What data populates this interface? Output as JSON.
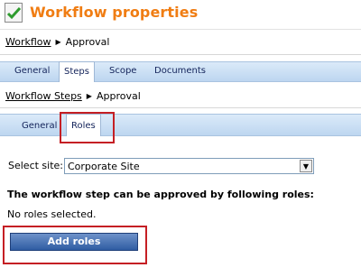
{
  "header": {
    "title": "Workflow properties",
    "icon": "checkmark-document-icon",
    "title_color": "#f07d13"
  },
  "breadcrumb_workflow": {
    "link": "Workflow",
    "separator": "▶",
    "current": "Approval"
  },
  "workflow_tabs": [
    {
      "label": "General",
      "active": false
    },
    {
      "label": "Steps",
      "active": true
    },
    {
      "label": "Scope",
      "active": false
    },
    {
      "label": "Documents",
      "active": false
    }
  ],
  "breadcrumb_steps": {
    "link": "Workflow Steps",
    "separator": "▶",
    "current": "Approval"
  },
  "step_tabs": [
    {
      "label": "General",
      "active": false
    },
    {
      "label": "Roles",
      "active": true
    }
  ],
  "site_selector": {
    "label": "Select site:",
    "value": "Corporate Site"
  },
  "roles": {
    "heading": "The workflow step can be approved by following roles:",
    "empty_message": "No roles selected.",
    "add_button": "Add roles"
  },
  "highlight_color": "#c51f24",
  "accent_color": "#2f5ca3"
}
